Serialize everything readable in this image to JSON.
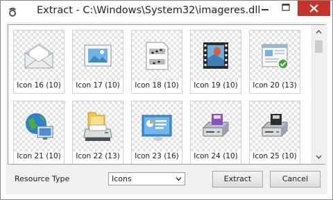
{
  "window": {
    "title": "Extract - C:\\Windows\\System32\\imageres.dll",
    "controls": [
      "minimize-icon",
      "maximize-icon",
      "close-icon"
    ]
  },
  "icons": [
    {
      "label": "Icon 16 (10)",
      "glyph": "mail-envelope-icon"
    },
    {
      "label": "Icon 17 (10)",
      "glyph": "picture-frame-icon"
    },
    {
      "label": "Icon 18 (10)",
      "glyph": "sheet-music-icon"
    },
    {
      "label": "Icon 19 (10)",
      "glyph": "film-strip-icon"
    },
    {
      "label": "Icon 20 (13)",
      "glyph": "document-check-icon"
    },
    {
      "label": "Icon 21 (10)",
      "glyph": "globe-network-icon"
    },
    {
      "label": "Icon 22 (13)",
      "glyph": "printer-folder-icon"
    },
    {
      "label": "Icon 23 (16)",
      "glyph": "control-panel-icon"
    },
    {
      "label": "Icon 24 (10)",
      "glyph": "floppy-drive-icon"
    },
    {
      "label": "Icon 25 (10)",
      "glyph": "floppy-drive-dark-icon"
    }
  ],
  "footer": {
    "resource_type_label": "Resource Type",
    "resource_type_value": "Icons",
    "extract_label": "Extract",
    "cancel_label": "Cancel"
  },
  "colors": {
    "close_button": "#c7322b",
    "dialog_background": "#f0f0f0"
  }
}
